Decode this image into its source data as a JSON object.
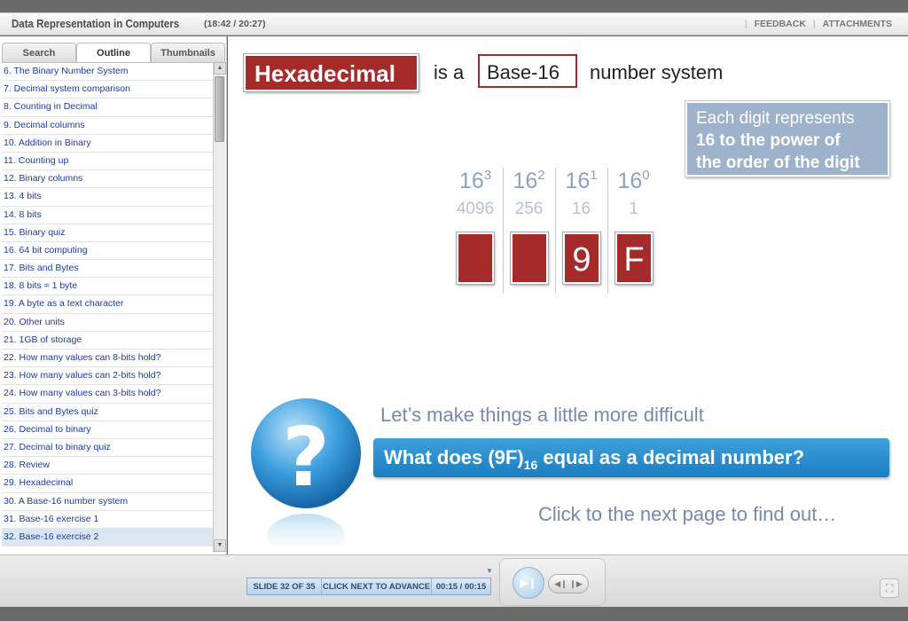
{
  "header": {
    "course_title": "Data Representation in Computers",
    "elapsed": "(18:42 / 20:27)",
    "feedback": "FEEDBACK",
    "attachments": "ATTACHMENTS"
  },
  "sidebar": {
    "tabs": [
      "Search",
      "Outline",
      "Thumbnails"
    ],
    "active_tab": "Outline",
    "items": [
      "6. The Binary Number System",
      "7. Decimal system comparison",
      "8. Counting in Decimal",
      "9. Decimal columns",
      "10. Addition in Binary",
      "11. Counting up",
      "12. Binary columns",
      "13. 4 bits",
      "14. 8 bits",
      "15. Binary quiz",
      "16. 64 bit computing",
      "17. Bits and Bytes",
      "18. 8 bits = 1 byte",
      "19. A byte as a text character",
      "20. Other units",
      "21. 1GB of storage",
      "22. How many values can 8-bits hold?",
      "23. How many values can 2-bits hold?",
      "24. How many values can 3-bits hold?",
      "25. Bits and Bytes quiz",
      "26. Decimal to binary",
      "27. Decimal to binary quiz",
      "28. Review",
      "29. Hexadecimal",
      "30. A Base-16 number system",
      "31. Base-16 exercise 1",
      "32. Base-16 exercise 2"
    ],
    "selected_item": "32. Base-16 exercise 2"
  },
  "slide": {
    "title_word": "Hexadecimal",
    "is_a": "is a",
    "base_label": "Base-16",
    "number_system": "number system",
    "info_line1": "Each digit represents",
    "info_line2": "16 to the power of",
    "info_line3": "the order of the digit",
    "columns": [
      {
        "base": "16",
        "exp": "3",
        "place": "4096",
        "digit": ""
      },
      {
        "base": "16",
        "exp": "2",
        "place": "256",
        "digit": ""
      },
      {
        "base": "16",
        "exp": "1",
        "place": "16",
        "digit": "9"
      },
      {
        "base": "16",
        "exp": "0",
        "place": "1",
        "digit": "F"
      }
    ],
    "lets_make": "Let’s make things a little more difficult",
    "question_pre": "What does (9F)",
    "question_sub": "16",
    "question_post": " equal as a decimal number?",
    "click_next": "Click to the next page to find out…"
  },
  "player": {
    "slide_counter": "SLIDE 32 OF 35",
    "advance_hint": "CLICK NEXT TO ADVANCE",
    "time": "00:15 / 00:15"
  },
  "colors": {
    "accent_red": "#a52b2b",
    "info_blue": "#9fb2cc",
    "question_blue": "#1a7fc0",
    "text_blue": "#7589ad"
  }
}
